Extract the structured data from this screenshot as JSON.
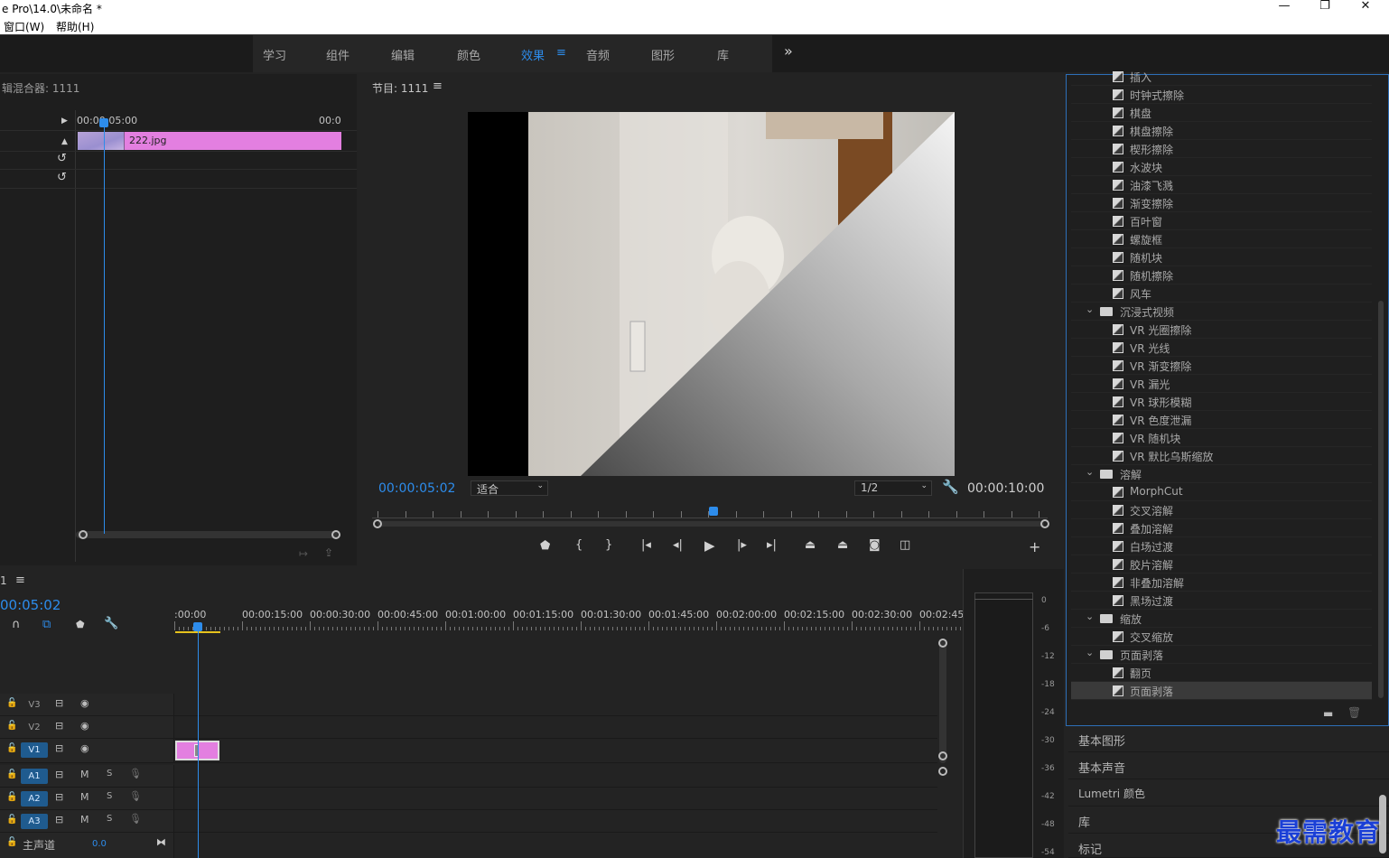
{
  "window": {
    "title": "e Pro\\14.0\\未命名 *",
    "controls": [
      "—",
      "❐",
      "✕"
    ]
  },
  "menu": {
    "items": [
      "窗口(W)",
      "帮助(H)"
    ]
  },
  "workspaces": {
    "tabs": [
      "学习",
      "组件",
      "编辑",
      "颜色",
      "效果",
      "音频",
      "图形",
      "库"
    ],
    "active": "效果",
    "menu_glyph": "≡",
    "more": "»"
  },
  "source": {
    "title": "辑混合器: 1111",
    "ruler_start": "00:00:05:00",
    "ruler_end": "00:0",
    "clip_name": "222.jpg"
  },
  "program": {
    "title": "节目: 1111",
    "menu_glyph": "≡",
    "current_time": "00:00:05:02",
    "fit": "适合",
    "resolution": "1/2",
    "duration": "00:00:10:00"
  },
  "effects": {
    "items": [
      {
        "type": "fx",
        "label": "插入"
      },
      {
        "type": "fx",
        "label": "时钟式擦除"
      },
      {
        "type": "fx",
        "label": "棋盘"
      },
      {
        "type": "fx",
        "label": "棋盘擦除"
      },
      {
        "type": "fx",
        "label": "楔形擦除"
      },
      {
        "type": "fx",
        "label": "水波块"
      },
      {
        "type": "fx",
        "label": "油漆飞溅"
      },
      {
        "type": "fx",
        "label": "渐变擦除"
      },
      {
        "type": "fx",
        "label": "百叶窗"
      },
      {
        "type": "fx",
        "label": "螺旋框"
      },
      {
        "type": "fx",
        "label": "随机块"
      },
      {
        "type": "fx",
        "label": "随机擦除"
      },
      {
        "type": "fx",
        "label": "风车"
      },
      {
        "type": "folder",
        "label": "沉浸式视频"
      },
      {
        "type": "fx",
        "label": "VR 光圈擦除"
      },
      {
        "type": "fx",
        "label": "VR 光线"
      },
      {
        "type": "fx",
        "label": "VR 渐变擦除"
      },
      {
        "type": "fx",
        "label": "VR 漏光"
      },
      {
        "type": "fx",
        "label": "VR 球形模糊"
      },
      {
        "type": "fx",
        "label": "VR 色度泄漏"
      },
      {
        "type": "fx",
        "label": "VR 随机块"
      },
      {
        "type": "fx",
        "label": "VR 默比乌斯缩放"
      },
      {
        "type": "folder",
        "label": "溶解"
      },
      {
        "type": "fx",
        "label": "MorphCut"
      },
      {
        "type": "fx",
        "label": "交叉溶解"
      },
      {
        "type": "fx",
        "label": "叠加溶解"
      },
      {
        "type": "fx",
        "label": "白场过渡"
      },
      {
        "type": "fx",
        "label": "胶片溶解"
      },
      {
        "type": "fx",
        "label": "非叠加溶解"
      },
      {
        "type": "fx",
        "label": "黑场过渡"
      },
      {
        "type": "folder",
        "label": "缩放"
      },
      {
        "type": "fx",
        "label": "交叉缩放"
      },
      {
        "type": "folder",
        "label": "页面剥落"
      },
      {
        "type": "fx",
        "label": "翻页"
      },
      {
        "type": "fx",
        "label": "页面剥落",
        "selected": true
      }
    ]
  },
  "side_panels": [
    "基本图形",
    "基本声音",
    "Lumetri 颜色",
    "库",
    "标记"
  ],
  "timeline": {
    "title": "1",
    "menu_glyph": "≡",
    "current_time": "00:05:02",
    "ruler": [
      ":00:00",
      "00:00:15:00",
      "00:00:30:00",
      "00:00:45:00",
      "00:01:00:00",
      "00:01:15:00",
      "00:01:30:00",
      "00:01:45:00",
      "00:02:00:00",
      "00:02:15:00",
      "00:02:30:00",
      "00:02:45:"
    ],
    "video_tracks": [
      "V3",
      "V2",
      "V1"
    ],
    "audio_tracks": [
      "A1",
      "A2",
      "A3"
    ],
    "master_label": "主声道",
    "master_value": "0.0",
    "mute": "M",
    "solo": "S"
  },
  "meter_scale": [
    "0",
    "-6",
    "-12",
    "-18",
    "-24",
    "-30",
    "-36",
    "-42",
    "-48",
    "-54"
  ],
  "watermark": "最需教育",
  "colors": {
    "accent": "#2d8ceb",
    "clip": "#e37fe0",
    "track_on": "#1f5b8f"
  }
}
